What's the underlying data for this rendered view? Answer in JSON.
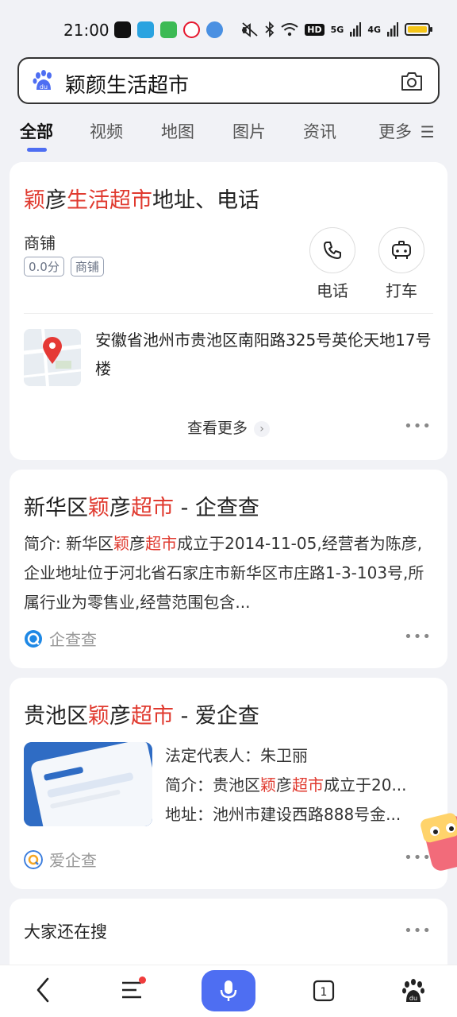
{
  "status_bar": {
    "time": "21:00",
    "network_label": "5G",
    "network_label_2": "4G",
    "hd_label": "HD"
  },
  "search": {
    "query": "颖颜生活超市"
  },
  "tabs": [
    {
      "label": "全部",
      "active": true
    },
    {
      "label": "视频"
    },
    {
      "label": "地图"
    },
    {
      "label": "图片"
    },
    {
      "label": "资讯"
    },
    {
      "label": "更多"
    }
  ],
  "card_store": {
    "title_parts": [
      "颖",
      "彦",
      "生活超市",
      "地址、电话"
    ],
    "category": "商铺",
    "badges": [
      "0.0分",
      "商铺"
    ],
    "actions": [
      {
        "label": "电话",
        "icon": "phone-icon"
      },
      {
        "label": "打车",
        "icon": "taxi-icon"
      }
    ],
    "address": "安徽省池州市贵池区南阳路325号英伦天地17号楼",
    "see_more": "查看更多"
  },
  "card_qcc": {
    "title_parts": [
      "新华区",
      "颖",
      "彦",
      "超市",
      " - 企查查"
    ],
    "desc_parts": [
      "简介: 新华区",
      "颖",
      "彦",
      "超市",
      "成立于2014-11-05,经营者为陈彦,企业地址位于河北省石家庄市新华区市庄路1-3-103号,所属行业为零售业,经营范围包含..."
    ],
    "source": "企查查"
  },
  "card_aqc": {
    "title_parts": [
      "贵池区",
      "颖",
      "彦",
      "超市",
      " - 爱企查"
    ],
    "legal_rep": "法定代表人：朱卫丽",
    "intro_parts": [
      "简介：贵池区",
      "颖",
      "彦",
      "超市",
      "成立于20..."
    ],
    "address": "地址：池州市建设西路888号金...",
    "source": "爱企查"
  },
  "card_related": {
    "title": "大家还在搜"
  },
  "colors": {
    "accent": "#4e6ef2",
    "highlight": "#e03a2f"
  }
}
